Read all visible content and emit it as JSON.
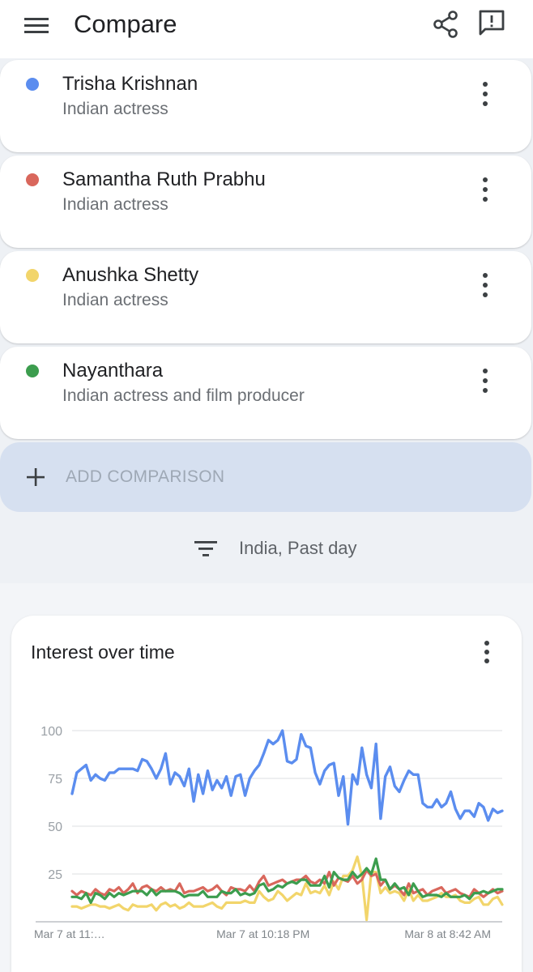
{
  "appbar": {
    "title": "Compare",
    "menu_icon": "menu-icon",
    "share_icon": "share-icon",
    "feedback_icon": "feedback-icon"
  },
  "terms": [
    {
      "name": "Trisha Krishnan",
      "description": "Indian actress",
      "color": "#5b8def"
    },
    {
      "name": "Samantha Ruth Prabhu",
      "description": "Indian actress",
      "color": "#d9675c"
    },
    {
      "name": "Anushka Shetty",
      "description": "Indian actress",
      "color": "#f2d56b"
    },
    {
      "name": "Nayanthara",
      "description": "Indian actress and film producer",
      "color": "#3c9d4e"
    }
  ],
  "add_comparison": {
    "label": "ADD COMPARISON"
  },
  "filter": {
    "label": "India, Past day"
  },
  "chart_card": {
    "title": "Interest over time"
  },
  "chart_data": {
    "type": "line",
    "title": "Interest over time",
    "ylim": [
      0,
      100
    ],
    "y_ticks": [
      "100",
      "75",
      "50",
      "25"
    ],
    "x_tick_labels": [
      "Mar 7 at 11:…",
      "Mar 7 at 10:18 PM",
      "Mar 8 at 8:42 AM"
    ],
    "x_tick_index": [
      0,
      45,
      90
    ],
    "grid": true,
    "series": [
      {
        "color": "#5b8def",
        "values": [
          67,
          78,
          80,
          82,
          74,
          77,
          75,
          74,
          78,
          78,
          80,
          80,
          80,
          80,
          79,
          85,
          84,
          80,
          75,
          80,
          88,
          72,
          78,
          76,
          71,
          80,
          63,
          77,
          67,
          79,
          69,
          74,
          70,
          76,
          66,
          76,
          77,
          66,
          75,
          79,
          82,
          88,
          95,
          93,
          95,
          100,
          84,
          83,
          85,
          98,
          92,
          91,
          78,
          72,
          79,
          82,
          83,
          66,
          76,
          51,
          77,
          72,
          91,
          77,
          70,
          93,
          54,
          76,
          81,
          71,
          68,
          74,
          79,
          77,
          77,
          62,
          60,
          60,
          64,
          60,
          62,
          68,
          59,
          54,
          58,
          58,
          55,
          62,
          60,
          53,
          59,
          57,
          58
        ]
      },
      {
        "color": "#d9675c",
        "values": [
          16,
          14,
          16,
          15,
          14,
          17,
          15,
          14,
          17,
          16,
          18,
          15,
          17,
          20,
          15,
          18,
          19,
          17,
          16,
          18,
          16,
          17,
          16,
          20,
          15,
          16,
          16,
          17,
          18,
          16,
          17,
          19,
          16,
          14,
          18,
          17,
          17,
          16,
          19,
          16,
          21,
          24,
          19,
          20,
          21,
          22,
          20,
          21,
          22,
          22,
          24,
          21,
          20,
          22,
          20,
          26,
          19,
          23,
          22,
          21,
          24,
          20,
          22,
          27,
          24,
          25,
          19,
          22,
          17,
          19,
          17,
          14,
          20,
          15,
          16,
          17,
          14,
          16,
          17,
          18,
          15,
          16,
          17,
          15,
          14,
          13,
          17,
          15,
          13,
          15,
          17,
          15,
          16
        ]
      },
      {
        "color": "#f2d56b",
        "values": [
          8,
          8,
          7,
          8,
          9,
          9,
          8,
          8,
          7,
          8,
          9,
          7,
          6,
          9,
          8,
          8,
          8,
          9,
          6,
          9,
          10,
          8,
          9,
          7,
          8,
          10,
          8,
          8,
          8,
          9,
          10,
          8,
          7,
          10,
          10,
          10,
          10,
          11,
          10,
          10,
          16,
          13,
          11,
          12,
          16,
          14,
          11,
          13,
          15,
          14,
          20,
          15,
          16,
          15,
          19,
          14,
          21,
          17,
          24,
          24,
          27,
          34,
          24,
          1,
          26,
          26,
          15,
          18,
          15,
          16,
          15,
          11,
          17,
          11,
          14,
          11,
          11,
          12,
          13,
          15,
          13,
          13,
          14,
          11,
          10,
          10,
          12,
          13,
          9,
          9,
          12,
          13,
          9
        ]
      },
      {
        "color": "#3c9d4e",
        "values": [
          13,
          13,
          12,
          15,
          10,
          15,
          14,
          12,
          15,
          13,
          15,
          14,
          15,
          16,
          16,
          16,
          14,
          17,
          14,
          16,
          16,
          16,
          16,
          15,
          13,
          14,
          14,
          14,
          16,
          13,
          13,
          13,
          16,
          15,
          15,
          17,
          14,
          15,
          14,
          15,
          19,
          20,
          16,
          17,
          19,
          18,
          20,
          21,
          20,
          22,
          22,
          19,
          19,
          19,
          24,
          18,
          26,
          23,
          22,
          22,
          26,
          23,
          25,
          28,
          25,
          33,
          22,
          22,
          17,
          20,
          17,
          18,
          14,
          20,
          16,
          13,
          14,
          14,
          14,
          13,
          15,
          13,
          13,
          13,
          14,
          12,
          15,
          15,
          16,
          15,
          16,
          17,
          17
        ]
      }
    ]
  }
}
